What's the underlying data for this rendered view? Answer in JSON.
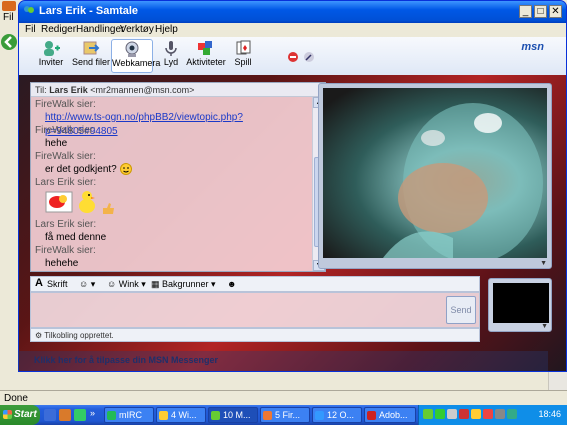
{
  "background": {
    "menu_label": "Fil",
    "status_text": "Done"
  },
  "window": {
    "title": "Lars Erik - Samtale",
    "minimize": "_",
    "maximize": "□",
    "close": "✕"
  },
  "menu": [
    "Fil",
    "Rediger",
    "Handlinger",
    "Verktøy",
    "Hjelp"
  ],
  "toolbar": {
    "items": [
      {
        "label": "Inviter",
        "icon": "invite-icon"
      },
      {
        "label": "Send filer",
        "icon": "send-files-icon"
      },
      {
        "label": "Webkamera",
        "icon": "webcam-icon"
      },
      {
        "label": "Lyd",
        "icon": "audio-icon"
      },
      {
        "label": "Aktiviteter",
        "icon": "activities-icon"
      },
      {
        "label": "Spill",
        "icon": "games-icon"
      }
    ],
    "logo": "msn"
  },
  "chat": {
    "to_label": "Til:",
    "to_name": "Lars Erik",
    "to_email": "<mr2mannen@msn.com>",
    "messages": [
      {
        "sender": "FireWalk sier:",
        "body": "http://www.ts-ogn.no/phpBB2/viewtopic.php?p=94805#94805",
        "link": true
      },
      {
        "sender": "FireWalk sier:",
        "body": "hehe"
      },
      {
        "sender": "FireWalk sier:",
        "body": "er det godkjent?"
      },
      {
        "sender": "Lars Erik sier:",
        "body": ""
      },
      {
        "sender": "Lars Erik sier:",
        "body": "få med denne"
      },
      {
        "sender": "FireWalk sier:",
        "body": "hehehe"
      }
    ]
  },
  "format_bar": {
    "font_label": "Skrift",
    "wink_label": "Wink",
    "background_label": "Bakgrunner"
  },
  "compose": {
    "send_label": "Send",
    "status": "Tilkobling opprettet."
  },
  "customize_link": "Klikk her for å tilpasse din MSN Messenger",
  "taskbar": {
    "start_label": "Start",
    "tasks": [
      {
        "label": "mIRC"
      },
      {
        "label": "4 Wi..."
      },
      {
        "label": "10 M..."
      },
      {
        "label": "5 Fir..."
      },
      {
        "label": "12 O..."
      },
      {
        "label": "Adob..."
      }
    ],
    "clock": "18:46"
  },
  "colors": {
    "accent": "#0058e6",
    "link": "#1a39c8",
    "taskbar": "#245edb",
    "start": "#3c9c3c"
  }
}
